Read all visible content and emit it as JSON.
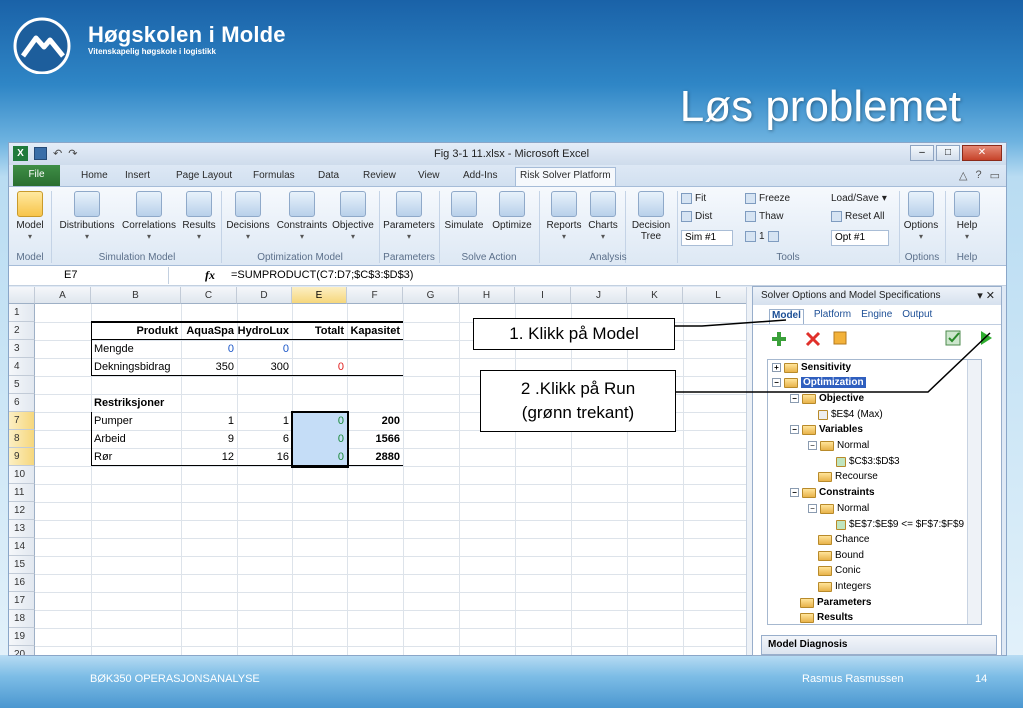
{
  "branding": {
    "logo_title": "Høgskolen i Molde",
    "logo_subtitle": "Vitenskapelig høgskole i logistikk",
    "logo_icon": "mountain-logo-icon"
  },
  "slide": {
    "title": "Løs problemet",
    "footer_left": "BØK350 OPERASJONSANALYSE",
    "footer_author": "Rasmus Rasmussen",
    "page_number": "14"
  },
  "window": {
    "title": "Fig 3-1 11.xlsx  -  Microsoft Excel"
  },
  "ribbon_tabs": [
    "File",
    "Home",
    "Insert",
    "Page Layout",
    "Formulas",
    "Data",
    "Review",
    "View",
    "Add-Ins",
    "Risk Solver Platform"
  ],
  "ribbon": {
    "buttons": [
      "Model",
      "Distributions",
      "Correlations",
      "Results",
      "Decisions",
      "Constraints",
      "Objective",
      "Parameters",
      "Simulate",
      "Optimize",
      "Reports",
      "Charts",
      "Decision Tree"
    ],
    "small": {
      "fit": "Fit",
      "dist": "Dist",
      "sim": "Sim #1",
      "freeze": "Freeze",
      "thaw": "Thaw",
      "step": "1",
      "loadsave": "Load/Save",
      "reset": "Reset All",
      "opt": "Opt #1",
      "options": "Options",
      "help": "Help"
    },
    "groups": [
      "Model",
      "Simulation Model",
      "Optimization Model",
      "Parameters",
      "Solve Action",
      "Analysis",
      "Tools",
      "Options",
      "Help"
    ]
  },
  "formula_bar": {
    "cell_ref": "E7",
    "fx": "fx",
    "formula": "=SUMPRODUCT(C7:D7;$C$3:$D$3)"
  },
  "sheet": {
    "columns": [
      "A",
      "B",
      "C",
      "D",
      "E",
      "F",
      "G",
      "H",
      "I",
      "J",
      "K",
      "L"
    ],
    "rows": [
      "1",
      "2",
      "3",
      "4",
      "5",
      "6",
      "7",
      "8",
      "9",
      "10",
      "11",
      "12",
      "13",
      "14",
      "15",
      "16",
      "17",
      "18",
      "19",
      "20"
    ],
    "cells": {
      "r2": [
        "Produkt",
        "AquaSpa",
        "HydroLux",
        "Totalt",
        "Kapasitet"
      ],
      "r3": [
        "Mengde",
        "0",
        "0"
      ],
      "r4": [
        "Dekningsbidrag",
        "350",
        "300",
        "0"
      ],
      "r6": [
        "Restriksjoner"
      ],
      "r7": [
        "Pumper",
        "1",
        "1",
        "0",
        "200"
      ],
      "r8": [
        "Arbeid",
        "9",
        "6",
        "0",
        "1566"
      ],
      "r9": [
        "Rør",
        "12",
        "16",
        "0",
        "2880"
      ]
    }
  },
  "callouts": {
    "step1": "1. Klikk på  Model",
    "step2_line1": "2 .Klikk på  Run",
    "step2_line2": "(grønn trekant)"
  },
  "pane": {
    "title": "Solver Options and Model Specifications",
    "tabs": [
      "Model",
      "Platform",
      "Engine",
      "Output"
    ],
    "tree": [
      "Sensitivity",
      "Optimization",
      "Objective",
      "$E$4 (Max)",
      "Variables",
      "Normal",
      "$C$3:$D$3",
      "Recourse",
      "Constraints",
      "Normal",
      "$E$7:$E$9 <= $F$7:$F$9",
      "Chance",
      "Bound",
      "Conic",
      "Integers",
      "Parameters",
      "Results"
    ],
    "diagnosis": "Model Diagnosis"
  }
}
